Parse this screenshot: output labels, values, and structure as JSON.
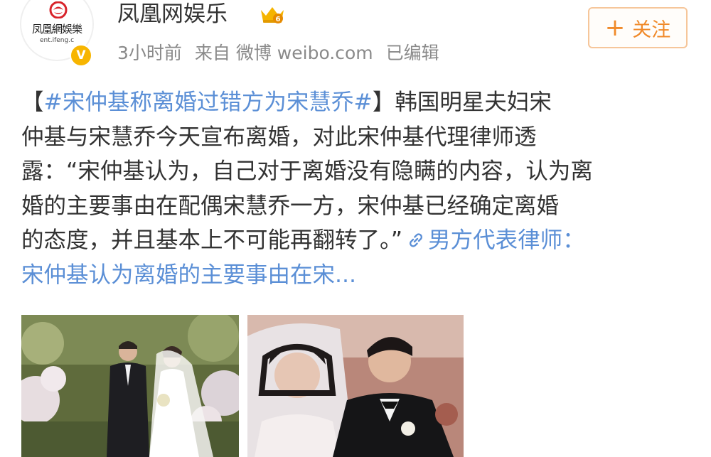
{
  "header": {
    "account_name": "凤凰网娱乐",
    "avatar_text": "凤凰網娛樂",
    "avatar_subtext": "ent.ifeng.c",
    "verified_glyph": "V",
    "time": "3小时前",
    "source": "来自 微博 weibo.com",
    "edited": "已编辑",
    "follow_label": "关注",
    "follow_plus": "+"
  },
  "post": {
    "bracket_open": "【",
    "hashtag": "#宋仲基称离婚过错方为宋慧乔#",
    "bracket_close": "】",
    "line1_rest": "韩国明星夫妇宋",
    "line2": "仲基与宋慧乔今天宣布离婚，对此宋仲基代理律师透",
    "line3": "露：“宋仲基认为，自己对于离婚没有隐瞒的内容，认为离",
    "line4": "婚的主要事由在配偶宋慧乔一方，宋仲基已经确定离婚",
    "line5_text": "的态度，并且基本上不可能再翻转了。”",
    "line5_link": "男方代表律师：",
    "line6_link": "宋仲基认为离婚的主要事由在宋..."
  },
  "icons": {
    "avatar_logo": "phoenix-logo-icon",
    "vip": "vip-badge-icon",
    "link": "link-icon"
  },
  "colors": {
    "link_blue": "#5b8fd6",
    "follow_orange": "#f08a2a",
    "meta_gray": "#8a8a8a",
    "text": "#333333"
  }
}
